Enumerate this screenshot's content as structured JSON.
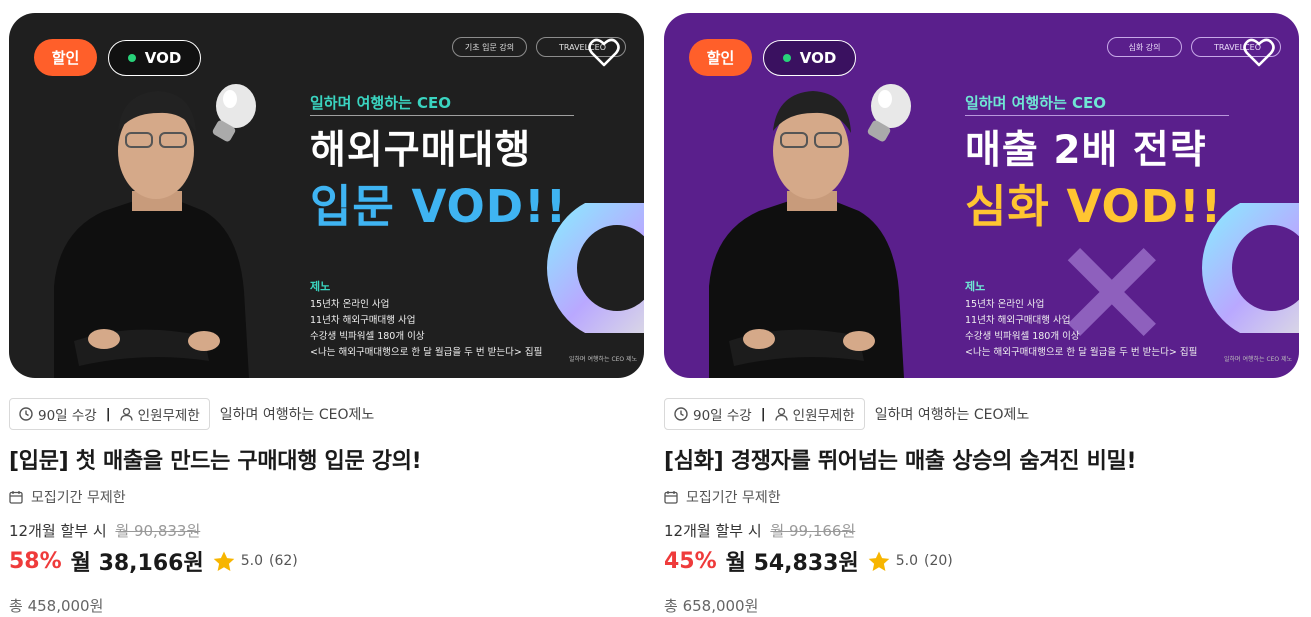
{
  "cards": [
    {
      "badge_sale": "할인",
      "badge_vod": "VOD",
      "top_tags": [
        "기초 입문 강의",
        "TRAVELCEO"
      ],
      "banner_subtitle": "일하며 여행하는 CEO",
      "banner_line1": "해외구매대행",
      "banner_line2": "입문 VOD!!",
      "instructor_name": "제노",
      "instructor_bio": [
        "15년차 온라인 사업",
        "11년차 해외구매대행 사업",
        "수강생 빅파워셀 180개 이상",
        "<나는 해외구매대행으로 한 달 월급을 두 번 받는다> 집필"
      ],
      "banner_credit": "일하며 여행하는 CEO 제노",
      "duration": "90일 수강",
      "capacity": "인원무제한",
      "author": "일하며 여행하는 CEO제노",
      "title": "[입문] 첫 매출을 만드는 구매대행 입문 강의!",
      "period": "모집기간 무제한",
      "installment_label": "12개월 할부 시",
      "original_monthly": "월 90,833원",
      "discount": "58%",
      "monthly_price": "월 38,166원",
      "rating": "5.0",
      "review_count": "(62)",
      "total": "총 458,000원"
    },
    {
      "badge_sale": "할인",
      "badge_vod": "VOD",
      "top_tags": [
        "심화 강의",
        "TRAVELCEO"
      ],
      "banner_subtitle": "일하며 여행하는 CEO",
      "banner_line1": "매출 2배 전략",
      "banner_line2": "심화 VOD!!",
      "instructor_name": "제노",
      "instructor_bio": [
        "15년차 온라인 사업",
        "11년차 해외구매대행 사업",
        "수강생 빅파워셀 180개 이상",
        "<나는 해외구매대행으로 한 달 월급을 두 번 받는다> 집필"
      ],
      "banner_credit": "일하며 여행하는 CEO 제노",
      "duration": "90일 수강",
      "capacity": "인원무제한",
      "author": "일하며 여행하는 CEO제노",
      "title": "[심화] 경쟁자를 뛰어넘는 매출 상승의 숨겨진 비밀!",
      "period": "모집기간 무제한",
      "installment_label": "12개월 할부 시",
      "original_monthly": "월 99,166원",
      "discount": "45%",
      "monthly_price": "월 54,833원",
      "rating": "5.0",
      "review_count": "(20)",
      "total": "총 658,000원"
    }
  ],
  "icons": {
    "clock": "clock-icon",
    "person": "person-icon",
    "calendar": "calendar-icon",
    "star": "star-icon",
    "heart": "heart-icon"
  },
  "colors": {
    "sale_badge": "#ff5f2a",
    "discount": "#ef3b3b",
    "star": "#f7b500",
    "card0_bg": "#1f1f1f",
    "card1_bg": "#5a1f8c"
  }
}
